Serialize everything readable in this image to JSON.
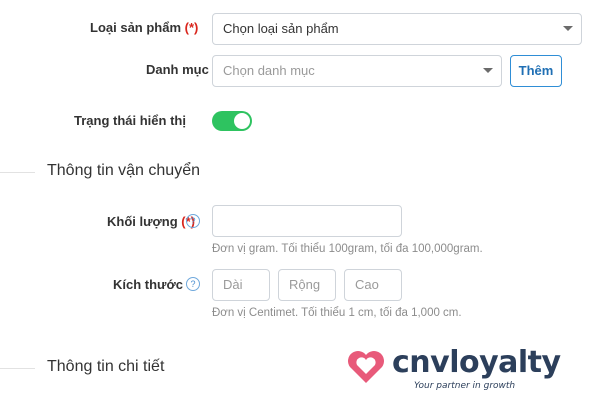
{
  "product_type": {
    "label": "Loại sản phẩm",
    "required_mark": "(*)",
    "value": "Chọn loại sản phẩm"
  },
  "category": {
    "label": "Danh mục",
    "placeholder": "Chọn danh mục",
    "add_button": "Thêm"
  },
  "display_status": {
    "label": "Trạng thái hiển thị",
    "enabled": true
  },
  "shipping_section": {
    "title": "Thông tin vận chuyển",
    "weight": {
      "label": "Khối lượng",
      "required_mark": "(*)",
      "value": "",
      "hint": "Đơn vị gram. Tối thiểu 100gram, tối đa 100,000gram."
    },
    "dimensions": {
      "label": "Kích thước",
      "length_placeholder": "Dài",
      "width_placeholder": "Rộng",
      "height_placeholder": "Cao",
      "hint": "Đơn vị Centimet. Tối thiểu 1 cm, tối đa 1,000 cm."
    },
    "help_glyph": "?"
  },
  "detail_section": {
    "title": "Thông tin chi tiết"
  },
  "logo": {
    "text": "cnvloyalty",
    "tagline": "Your partner in growth",
    "heart_color": "#e85a7a",
    "text_color": "#2c3f5b"
  },
  "colors": {
    "toggle_on": "#2ec360",
    "required": "#d9251c",
    "accent": "#2f8ed6"
  }
}
